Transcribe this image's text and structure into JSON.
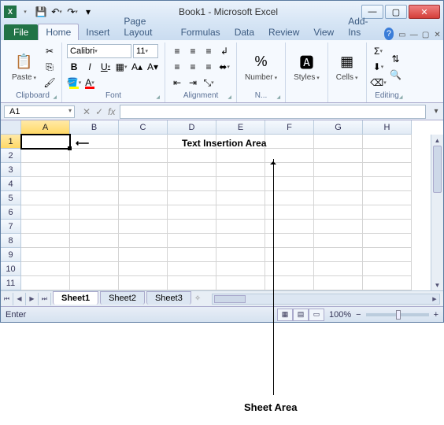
{
  "title": "Book1 - Microsoft Excel",
  "qat": {
    "save": "💾",
    "undo": "↶",
    "redo": "↷"
  },
  "tabs": {
    "file": "File",
    "items": [
      "Home",
      "Insert",
      "Page Layout",
      "Formulas",
      "Data",
      "Review",
      "View",
      "Add-Ins"
    ],
    "active": "Home"
  },
  "ribbon": {
    "clipboard": {
      "label": "Clipboard",
      "paste": "Paste"
    },
    "font": {
      "label": "Font",
      "name": "Calibri",
      "size": "11",
      "bold": "B",
      "italic": "I",
      "underline": "U"
    },
    "alignment": {
      "label": "Alignment"
    },
    "number": {
      "label": "N...",
      "btn": "Number",
      "sym": "%"
    },
    "styles": {
      "label": "",
      "btn": "Styles"
    },
    "cells": {
      "label": "",
      "btn": "Cells"
    },
    "editing": {
      "label": "Editing",
      "sigma": "Σ"
    }
  },
  "namebox": "A1",
  "fx": {
    "cancel": "✕",
    "enter": "✓",
    "fx": "fx"
  },
  "columns": [
    "A",
    "B",
    "C",
    "D",
    "E",
    "F",
    "G",
    "H"
  ],
  "rows": [
    "1",
    "2",
    "3",
    "4",
    "5",
    "6",
    "7",
    "8",
    "9",
    "10",
    "11"
  ],
  "selected": {
    "col": "A",
    "row": "1"
  },
  "sheets": {
    "items": [
      "Sheet1",
      "Sheet2",
      "Sheet3"
    ],
    "active": "Sheet1"
  },
  "status": {
    "mode": "Enter",
    "zoom": "100%"
  },
  "annotations": {
    "text_insertion": "Text Insertion Area",
    "sheet_area": "Sheet Area"
  }
}
